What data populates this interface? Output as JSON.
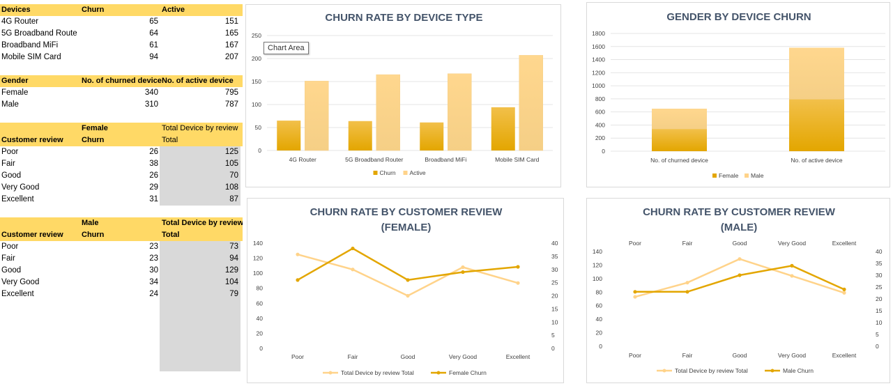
{
  "tables": {
    "devices": {
      "headers": [
        "Devices",
        "Churn",
        "Active"
      ],
      "rows": [
        [
          "4G Router",
          "65",
          "151"
        ],
        [
          "5G Broadband Route",
          "64",
          "165"
        ],
        [
          "Broadband MiFi",
          "61",
          "167"
        ],
        [
          "Mobile SIM Card",
          "94",
          "207"
        ]
      ]
    },
    "gender": {
      "headers": [
        "Gender",
        "No. of churned device",
        "No. of active device"
      ],
      "rows": [
        [
          "Female",
          "340",
          "795"
        ],
        [
          "Male",
          "310",
          "787"
        ]
      ]
    },
    "female_review": {
      "header_top": [
        "",
        "Female",
        "Total Device by review"
      ],
      "headers": [
        "Customer review",
        "Churn",
        "Total"
      ],
      "rows": [
        [
          "Poor",
          "26",
          "125"
        ],
        [
          "Fair",
          "38",
          "105"
        ],
        [
          "Good",
          "26",
          "70"
        ],
        [
          "Very Good",
          "29",
          "108"
        ],
        [
          "Excellent",
          "31",
          "87"
        ]
      ]
    },
    "male_review": {
      "header_top": [
        "",
        "Male",
        "Total Device by review"
      ],
      "headers": [
        "Customer review",
        "Churn",
        "Total"
      ],
      "rows": [
        [
          "Poor",
          "23",
          "73"
        ],
        [
          "Fair",
          "23",
          "94"
        ],
        [
          "Good",
          "30",
          "129"
        ],
        [
          "Very Good",
          "34",
          "104"
        ],
        [
          "Excellent",
          "24",
          "79"
        ]
      ]
    }
  },
  "tooltip": "Chart Area",
  "colors": {
    "header_fill": "#ffd966",
    "dark_series": "#e3a600",
    "light_series": "#ffd38a",
    "grey_fill": "#d9d9d9",
    "title": "#44546a"
  },
  "chart_data": [
    {
      "type": "bar",
      "title": "CHURN RATE BY DEVICE TYPE",
      "categories": [
        "4G Router",
        "5G Broadband Router",
        "Broadband MiFi",
        "Mobile SIM Card"
      ],
      "series": [
        {
          "name": "Churn",
          "values": [
            65,
            64,
            61,
            94
          ]
        },
        {
          "name": "Active",
          "values": [
            151,
            165,
            167,
            207
          ]
        }
      ],
      "ylim": [
        0,
        250
      ],
      "yticks": [
        "0",
        "50",
        "100",
        "150",
        "200",
        "250"
      ],
      "grid": true,
      "legend": "bottom"
    },
    {
      "type": "bar",
      "title": "GENDER BY DEVICE CHURN",
      "categories": [
        "No. of churned device",
        "No. of active device"
      ],
      "series": [
        {
          "name": "Female",
          "values": [
            340,
            795
          ]
        },
        {
          "name": "Male",
          "values": [
            310,
            787
          ]
        }
      ],
      "stacked": true,
      "ylim": [
        0,
        1800
      ],
      "yticks": [
        "0",
        "200",
        "400",
        "600",
        "800",
        "1000",
        "1200",
        "1400",
        "1600",
        "1800"
      ],
      "grid": true,
      "legend": "bottom"
    },
    {
      "type": "line",
      "title": "CHURN RATE BY CUSTOMER REVIEW",
      "subtitle": "(FEMALE)",
      "categories": [
        "Poor",
        "Fair",
        "Good",
        "Very Good",
        "Excellent"
      ],
      "series": [
        {
          "name": "Total Device by review Total",
          "values": [
            125,
            105,
            70,
            108,
            87
          ],
          "axis": "left"
        },
        {
          "name": "Female Churn",
          "values": [
            26,
            38,
            26,
            29,
            31
          ],
          "axis": "right"
        }
      ],
      "ylim": [
        0,
        140
      ],
      "yticks": [
        "0",
        "20",
        "40",
        "60",
        "80",
        "100",
        "120",
        "140"
      ],
      "y2lim": [
        0,
        40
      ],
      "y2ticks": [
        "0",
        "5",
        "10",
        "15",
        "20",
        "25",
        "30",
        "35",
        "40"
      ],
      "grid": false,
      "legend": "bottom"
    },
    {
      "type": "line",
      "title": "CHURN RATE BY CUSTOMER REVIEW",
      "subtitle": "(MALE)",
      "categories": [
        "Poor",
        "Fair",
        "Good",
        "Very Good",
        "Excellent"
      ],
      "series": [
        {
          "name": "Total Device by review Total",
          "values": [
            73,
            94,
            129,
            104,
            79
          ],
          "axis": "left"
        },
        {
          "name": "Male Churn",
          "values": [
            23,
            23,
            30,
            34,
            24
          ],
          "axis": "right"
        }
      ],
      "ylim": [
        0,
        140
      ],
      "yticks": [
        "0",
        "20",
        "40",
        "60",
        "80",
        "100",
        "120",
        "140"
      ],
      "y2lim": [
        0,
        40
      ],
      "y2ticks": [
        "0",
        "5",
        "10",
        "15",
        "20",
        "25",
        "30",
        "35",
        "40"
      ],
      "grid": false,
      "legend": "bottom"
    }
  ]
}
